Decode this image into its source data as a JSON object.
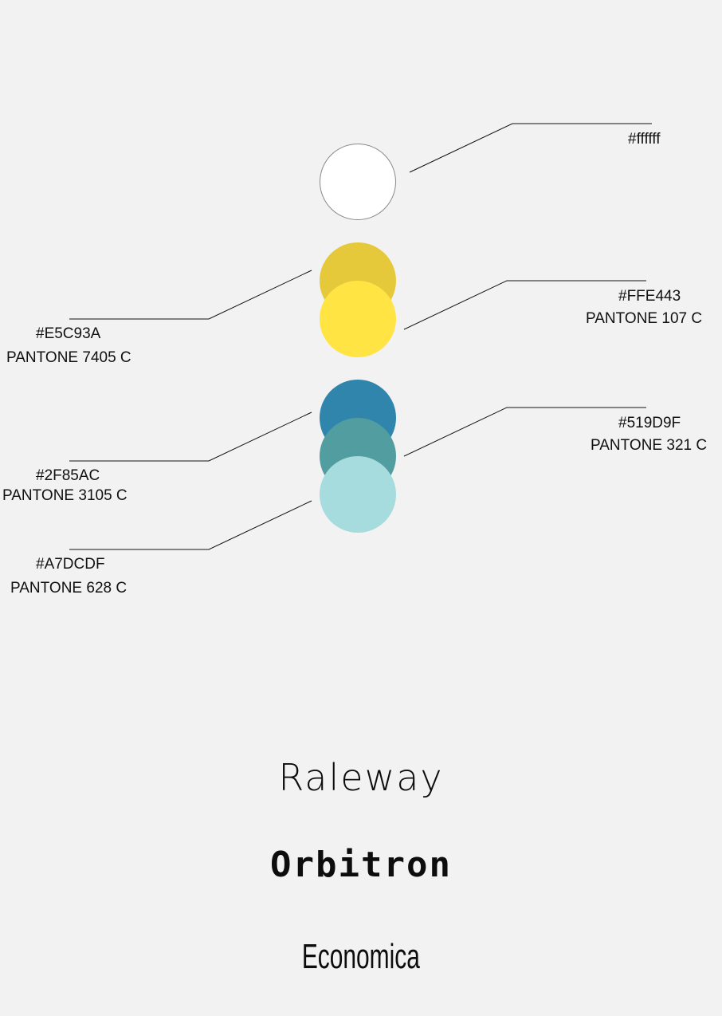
{
  "swatches": [
    {
      "id": "white",
      "color": "#ffffff",
      "outline": "#8a8a8a",
      "labels": [
        "#ffffff"
      ],
      "side": "right"
    },
    {
      "id": "e5c93a",
      "color": "#E5C93A",
      "labels": [
        "#E5C93A",
        "PANTONE 7405 C"
      ],
      "side": "left"
    },
    {
      "id": "ffe443",
      "color": "#FFE443",
      "labels": [
        "#FFE443",
        "PANTONE 107 C"
      ],
      "side": "right"
    },
    {
      "id": "2f85ac",
      "color": "#2F85AC",
      "labels": [
        "#2F85AC",
        "PANTONE 3105 C"
      ],
      "side": "left"
    },
    {
      "id": "519d9f",
      "color": "#519D9F",
      "labels": [
        "#519D9F",
        "PANTONE 321 C"
      ],
      "side": "right"
    },
    {
      "id": "a7dcdf",
      "color": "#A7DCDF",
      "labels": [
        "#A7DCDF",
        "PANTONE 628 C"
      ],
      "side": "left"
    }
  ],
  "fonts": [
    "Raleway",
    "Orbitron",
    "Economica"
  ]
}
